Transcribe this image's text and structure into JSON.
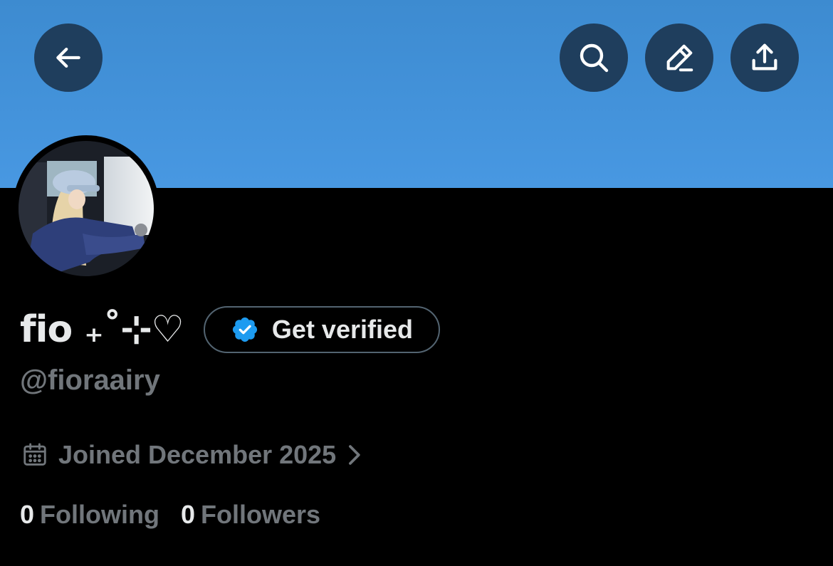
{
  "header": {
    "banner_color": "#4898e2",
    "buttons": [
      {
        "name": "back",
        "icon": "arrow-left-icon"
      },
      {
        "name": "search",
        "icon": "search-icon"
      },
      {
        "name": "edit",
        "icon": "pencil-icon"
      },
      {
        "name": "share",
        "icon": "share-upload-icon"
      }
    ]
  },
  "profile": {
    "avatar": "profile-photo",
    "display_name": "fio ₊˚⊹♡",
    "verify_label": "Get verified",
    "verify_badge_color": "#1d9bf0",
    "handle": "@fioraairy",
    "joined": "Joined December 2025",
    "following_count": "0",
    "following_label": "Following",
    "followers_count": "0",
    "followers_label": "Followers"
  }
}
